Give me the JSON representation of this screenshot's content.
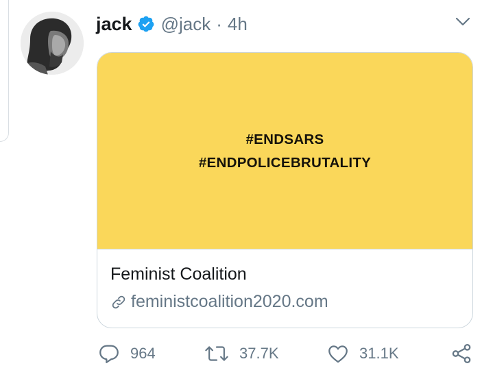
{
  "tweet": {
    "author_name": "jack",
    "handle": "@jack",
    "separator": "·",
    "time": "4h",
    "verified": true
  },
  "card": {
    "image_lines": [
      "#ENDSARS",
      "#ENDPOLICEBRUTALITY"
    ],
    "image_bg_color": "#fad75a",
    "title": "Feminist Coalition",
    "link_domain": "feministcoalition2020.com"
  },
  "actions": {
    "replies": "964",
    "retweets": "37.7K",
    "likes": "31.1K"
  },
  "icons": {
    "verified": "verified-badge-icon",
    "menu": "chevron-down-icon",
    "link": "link-icon",
    "reply": "reply-icon",
    "retweet": "retweet-icon",
    "like": "heart-icon",
    "share": "share-icon"
  },
  "colors": {
    "verified_blue": "#1da1f2",
    "secondary_text": "#657786",
    "primary_text": "#14171a",
    "border": "#ccd6dd"
  }
}
